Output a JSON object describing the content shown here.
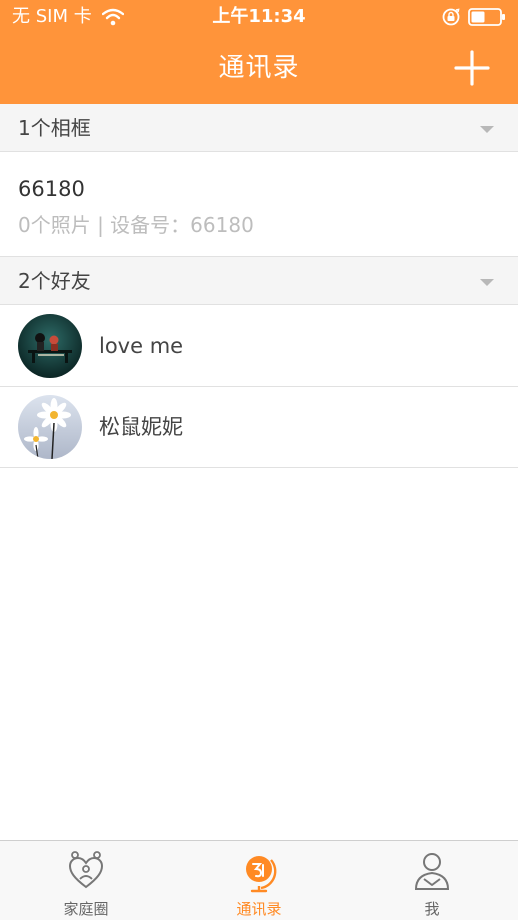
{
  "status_bar": {
    "carrier": "无 SIM 卡",
    "time": "上午11:34"
  },
  "nav": {
    "title": "通讯录",
    "add_icon": "plus-icon"
  },
  "frames_section": {
    "header": "1个相框",
    "items": [
      {
        "name": "66180",
        "detail": "0个照片 | 设备号：66180"
      }
    ]
  },
  "friends_section": {
    "header": "2个好友",
    "items": [
      {
        "name": "love me",
        "avatar": "dark-teal-avatar"
      },
      {
        "name": "松鼠妮妮",
        "avatar": "daisy-avatar"
      }
    ]
  },
  "tab_bar": {
    "tabs": [
      {
        "label": "家庭圈",
        "icon": "family-heart-icon",
        "active": false
      },
      {
        "label": "通讯录",
        "icon": "contacts-globe-icon",
        "active": true
      },
      {
        "label": "我",
        "icon": "person-icon",
        "active": false
      }
    ]
  },
  "colors": {
    "accent": "#FF943A",
    "active_tab": "#FF8A24",
    "section_bg": "#F5F5F5",
    "muted_text": "#BDBDBD"
  }
}
